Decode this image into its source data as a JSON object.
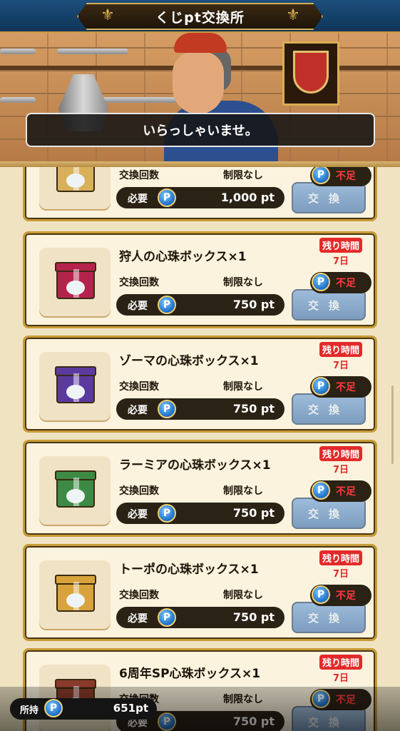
{
  "header": {
    "title": "くじpt交換所"
  },
  "scene": {
    "speech": "いらっしゃいませ。"
  },
  "labels": {
    "count_label": "交換回数",
    "cost_label": "必要",
    "exchange_button": "交換",
    "shortage": "不足",
    "timer_badge": "残り時間",
    "p_icon": "P"
  },
  "items": [
    {
      "name": "",
      "count": "制限なし",
      "cost": "1,000 pt",
      "timer": "",
      "days": "",
      "color": "#d8b05a"
    },
    {
      "name": "狩人の心珠ボックス×1",
      "count": "制限なし",
      "cost": "750 pt",
      "timer": "残り時間",
      "days": "7日",
      "color": "#b5234c"
    },
    {
      "name": "ゾーマの心珠ボックス×1",
      "count": "制限なし",
      "cost": "750 pt",
      "timer": "残り時間",
      "days": "7日",
      "color": "#5b3aa0"
    },
    {
      "name": "ラーミアの心珠ボックス×1",
      "count": "制限なし",
      "cost": "750 pt",
      "timer": "残り時間",
      "days": "7日",
      "color": "#3d8a44"
    },
    {
      "name": "トーポの心珠ボックス×1",
      "count": "制限なし",
      "cost": "750 pt",
      "timer": "残り時間",
      "days": "7日",
      "color": "#d8a33a"
    },
    {
      "name": "6周年SP心珠ボックス×1",
      "count": "制限なし",
      "cost": "750 pt",
      "timer": "残り時間",
      "days": "7日",
      "color": "#8a3a2a"
    }
  ],
  "owned": {
    "label": "所持",
    "value": "651pt"
  }
}
